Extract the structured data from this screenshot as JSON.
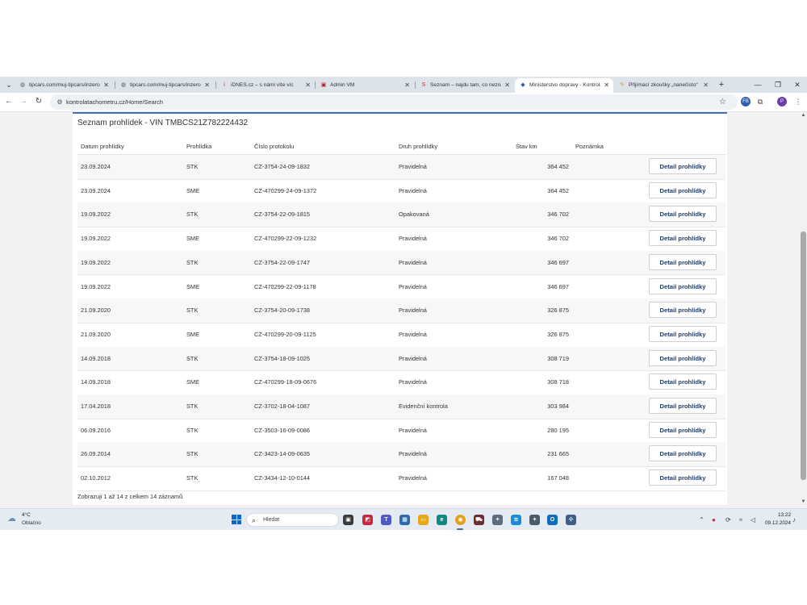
{
  "browser": {
    "tabs": [
      {
        "title": "tipcars.com/muj-tipcars/inzerce",
        "favicon": "globe-icon",
        "active": false
      },
      {
        "title": "tipcars.com/muj-tipcars/inzerce",
        "favicon": "globe-icon",
        "active": false
      },
      {
        "title": "iDNES.cz – s námi víte víc",
        "favicon": "idnes-logo-icon",
        "active": false
      },
      {
        "title": "Admin VM",
        "favicon": "admin-logo-icon",
        "active": false
      },
      {
        "title": "Seznam – najdu tam, co nezná",
        "favicon": "seznam-logo-icon",
        "active": false
      },
      {
        "title": "Ministerstvo dopravy - Kontrola",
        "favicon": "ministry-logo-icon",
        "active": true
      },
      {
        "title": "Přijímací zkoušky „nanečisto“",
        "favicon": "exam-logo-icon",
        "active": false
      }
    ],
    "url": "kontrolatachometru.cz/Home/Search",
    "profile_initial": "P",
    "extension_label": "FB"
  },
  "page": {
    "title": "Seznam prohlídek - VIN TMBCS21Z782224432",
    "columns": [
      "Datum prohlídky",
      "Prohlídka",
      "Číslo protokolu",
      "Druh prohlídky",
      "Stav km",
      "Poznámka"
    ],
    "detail_button_label": "Detail prohlídky",
    "rows": [
      {
        "date": "23.09.2024",
        "type": "STK",
        "protocol": "CZ-3754-24-09-1832",
        "kind": "Pravidelná",
        "km": "364 452",
        "note": ""
      },
      {
        "date": "23.09.2024",
        "type": "SME",
        "protocol": "CZ-470299-24-09-1372",
        "kind": "Pravidelná",
        "km": "364 452",
        "note": ""
      },
      {
        "date": "19.09.2022",
        "type": "STK",
        "protocol": "CZ-3754-22-09-1815",
        "kind": "Opakovaná",
        "km": "346 702",
        "note": ""
      },
      {
        "date": "19.09.2022",
        "type": "SME",
        "protocol": "CZ-470299-22-09-1232",
        "kind": "Pravidelná",
        "km": "346 702",
        "note": ""
      },
      {
        "date": "19.09.2022",
        "type": "STK",
        "protocol": "CZ-3754-22-09-1747",
        "kind": "Pravidelná",
        "km": "346 697",
        "note": ""
      },
      {
        "date": "19.09.2022",
        "type": "SME",
        "protocol": "CZ-470299-22-09-1178",
        "kind": "Pravidelná",
        "km": "346 697",
        "note": ""
      },
      {
        "date": "21.09.2020",
        "type": "STK",
        "protocol": "CZ-3754-20-09-1738",
        "kind": "Pravidelná",
        "km": "326 875",
        "note": ""
      },
      {
        "date": "21.09.2020",
        "type": "SME",
        "protocol": "CZ-470299-20-09-1125",
        "kind": "Pravidelná",
        "km": "326 875",
        "note": ""
      },
      {
        "date": "14.09.2018",
        "type": "STK",
        "protocol": "CZ-3754-18-09-1025",
        "kind": "Pravidelná",
        "km": "308 719",
        "note": ""
      },
      {
        "date": "14.09.2018",
        "type": "SME",
        "protocol": "CZ-470299-18-09-0676",
        "kind": "Pravidelná",
        "km": "308 718",
        "note": ""
      },
      {
        "date": "17.04.2018",
        "type": "STK",
        "protocol": "CZ-3702-18-04-1087",
        "kind": "Evidenční kontrola",
        "km": "303 984",
        "note": ""
      },
      {
        "date": "06.09.2016",
        "type": "STK",
        "protocol": "CZ-3503-16-09-0086",
        "kind": "Pravidelná",
        "km": "280 195",
        "note": ""
      },
      {
        "date": "26.09.2014",
        "type": "STK",
        "protocol": "CZ-3423-14-09-0635",
        "kind": "Pravidelná",
        "km": "231 665",
        "note": ""
      },
      {
        "date": "02.10.2012",
        "type": "STK",
        "protocol": "CZ-3434-12-10-0144",
        "kind": "Pravidelná",
        "km": "167 048",
        "note": ""
      }
    ],
    "footer": "Zobrazuji 1 až 14 z celkem 14 záznamů"
  },
  "taskbar": {
    "weather_temp": "4°C",
    "weather_desc": "Oblačno",
    "search_placeholder": "Hledat",
    "time": "13:22",
    "date": "09.12.2024"
  },
  "colors": {
    "accent": "#3f72b5",
    "button_text": "#1f3f6e"
  }
}
